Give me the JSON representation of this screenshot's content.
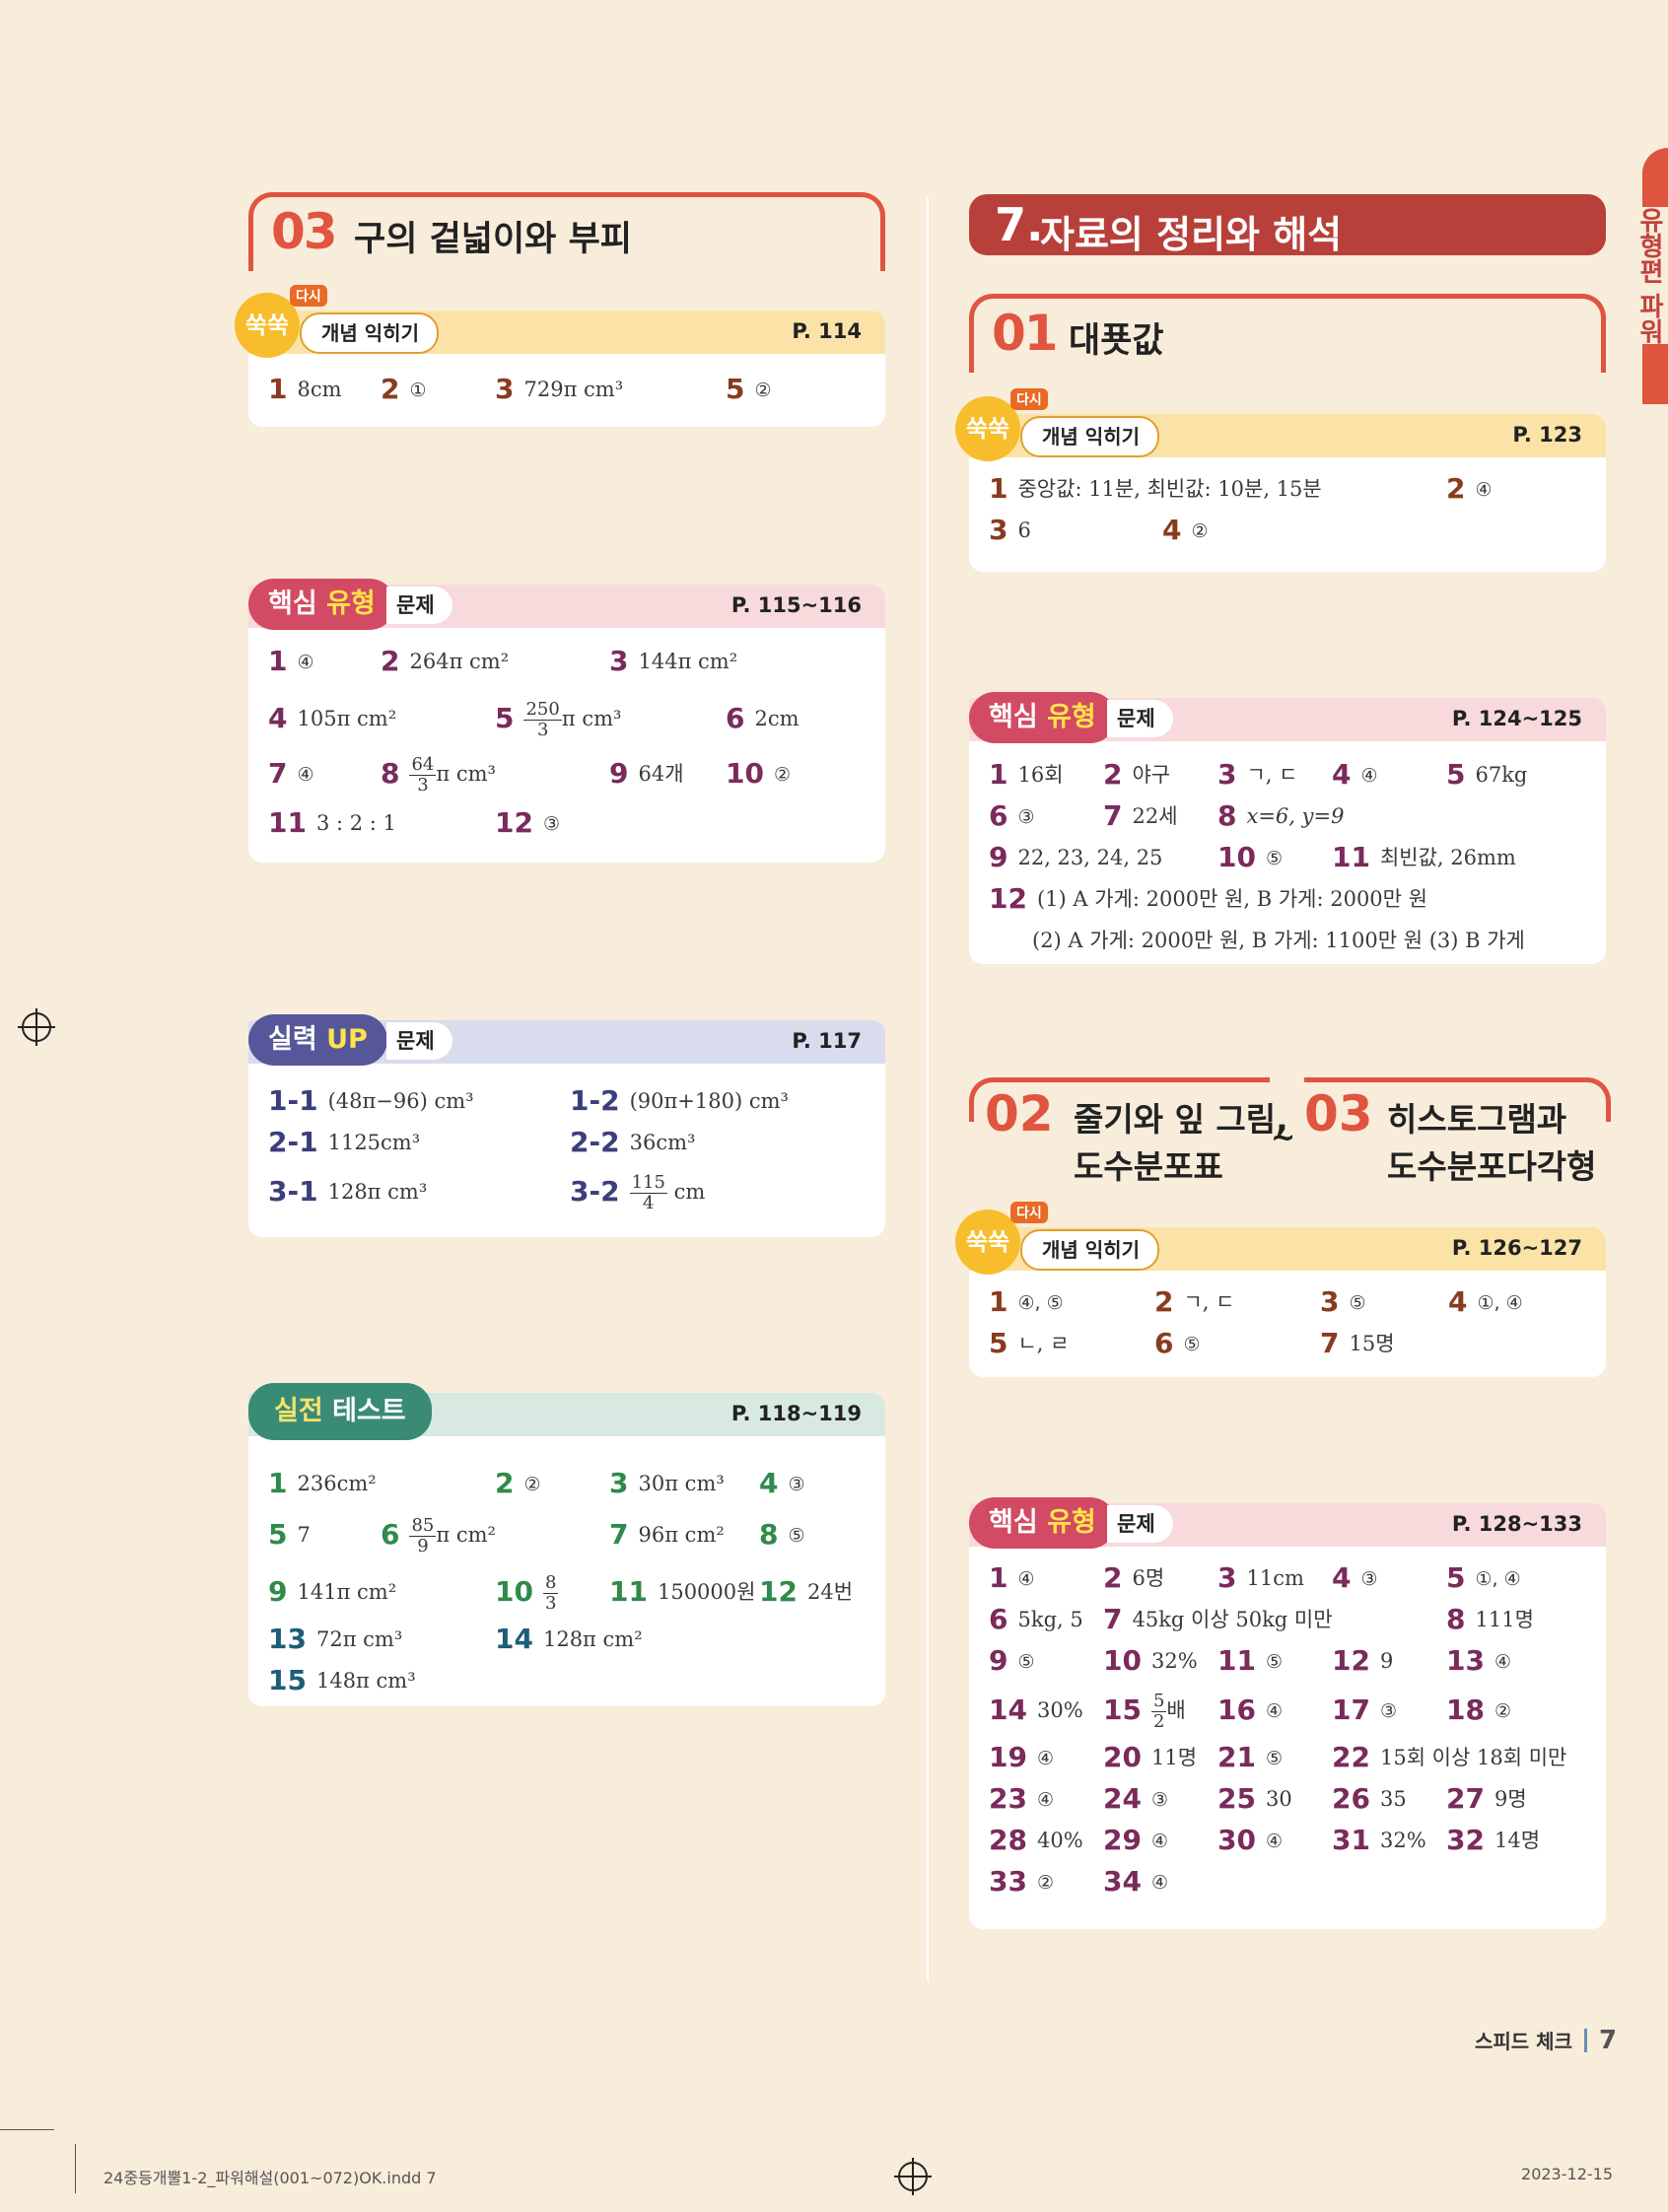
{
  "side_tab": "유형편 파워",
  "left": {
    "section_title": {
      "num": "03",
      "title": "구의 겉넓이와 부피"
    },
    "concept": {
      "badge": "쑥쑥",
      "tag": "다시",
      "label": "개념 익히기",
      "page": "P. 114",
      "answers": [
        {
          "n": "1",
          "v": "8cm"
        },
        {
          "n": "2",
          "v": "①"
        },
        {
          "n": "3",
          "v": "729π cm³"
        },
        {
          "n": "5",
          "v": "②"
        }
      ]
    },
    "core": {
      "label_a": "핵심",
      "label_b": "유형",
      "tail": "문제",
      "page": "P. 115~116",
      "answers": {
        "r1": [
          {
            "n": "1",
            "v": "④"
          },
          {
            "n": "2",
            "v": "264π cm²"
          },
          {
            "n": "3",
            "v": "144π cm²"
          }
        ],
        "r2": [
          {
            "n": "4",
            "v": "105π cm²"
          },
          {
            "n": "5",
            "num": "250",
            "den": "3",
            "v": "π cm³"
          },
          {
            "n": "6",
            "v": "2cm"
          }
        ],
        "r3": [
          {
            "n": "7",
            "v": "④"
          },
          {
            "n": "8",
            "num": "64",
            "den": "3",
            "v": "π cm³"
          },
          {
            "n": "9",
            "v": "64개"
          },
          {
            "n": "10",
            "v": "②"
          }
        ],
        "r4": [
          {
            "n": "11",
            "v": "3 : 2 : 1"
          },
          {
            "n": "12",
            "v": "③"
          }
        ]
      }
    },
    "up": {
      "label_a": "실력",
      "label_b": "UP",
      "tail": "문제",
      "page": "P. 117",
      "answers": [
        {
          "n": "1-1",
          "v": "(48π−96) cm³"
        },
        {
          "n": "1-2",
          "v": "(90π+180) cm³"
        },
        {
          "n": "2-1",
          "v": "1125cm³"
        },
        {
          "n": "2-2",
          "v": "36cm³"
        },
        {
          "n": "3-1",
          "v": "128π cm³"
        },
        {
          "n": "3-2",
          "num": "115",
          "den": "4",
          "v": "cm"
        }
      ]
    },
    "test": {
      "label_a": "실전",
      "label_b": "테스트",
      "page": "P. 118~119",
      "answers": {
        "r1": [
          {
            "n": "1",
            "v": "236cm²"
          },
          {
            "n": "2",
            "v": "②"
          },
          {
            "n": "3",
            "v": "30π cm³"
          },
          {
            "n": "4",
            "v": "③"
          }
        ],
        "r2": [
          {
            "n": "5",
            "v": "7"
          },
          {
            "n": "6",
            "num": "85",
            "den": "9",
            "v": "π cm²"
          },
          {
            "n": "7",
            "v": "96π cm²"
          },
          {
            "n": "8",
            "v": "⑤"
          }
        ],
        "r3": [
          {
            "n": "9",
            "v": "141π cm²"
          },
          {
            "n": "10",
            "num": "8",
            "den": "3"
          },
          {
            "n": "11",
            "v": "150000원"
          },
          {
            "n": "12",
            "v": "24번"
          }
        ],
        "r4": [
          {
            "n": "13",
            "v": "72π cm³"
          },
          {
            "n": "14",
            "v": "128π cm²"
          }
        ],
        "r5": [
          {
            "n": "15",
            "v": "148π cm³"
          }
        ]
      }
    }
  },
  "right": {
    "chapter": {
      "num": "7.",
      "title": "자료의 정리와 해석"
    },
    "sec1": {
      "num": "01",
      "title": "대푯값",
      "concept": {
        "badge": "쑥쑥",
        "tag": "다시",
        "label": "개념 익히기",
        "page": "P. 123",
        "answers": [
          {
            "n": "1",
            "v": "중앙값: 11분, 최빈값: 10분, 15분"
          },
          {
            "n": "2",
            "v": "④"
          },
          {
            "n": "3",
            "v": "6"
          },
          {
            "n": "4",
            "v": "②"
          }
        ]
      },
      "core": {
        "label_a": "핵심",
        "label_b": "유형",
        "tail": "문제",
        "page": "P. 124~125",
        "answers": {
          "r1": [
            {
              "n": "1",
              "v": "16회"
            },
            {
              "n": "2",
              "v": "야구"
            },
            {
              "n": "3",
              "v": "ㄱ, ㄷ"
            },
            {
              "n": "4",
              "v": "④"
            },
            {
              "n": "5",
              "v": "67kg"
            }
          ],
          "r2": [
            {
              "n": "6",
              "v": "③"
            },
            {
              "n": "7",
              "v": "22세"
            },
            {
              "n": "8",
              "v": "x=6, y=9"
            }
          ],
          "r3": [
            {
              "n": "9",
              "v": "22, 23, 24, 25"
            },
            {
              "n": "10",
              "v": "⑤"
            },
            {
              "n": "11",
              "v": "최빈값, 26mm"
            }
          ],
          "r4": [
            {
              "n": "12",
              "v": "(1) A 가게: 2000만 원, B 가게: 2000만 원"
            }
          ],
          "r5": {
            "v": "(2) A 가게: 2000만 원, B 가게: 1100만 원   (3) B 가게"
          }
        }
      }
    },
    "sec2": {
      "num_a": "02",
      "title_a1": "줄기와 잎 그림,",
      "title_a2": "도수분포표",
      "tilde": "~",
      "num_b": "03",
      "title_b1": "히스토그램과",
      "title_b2": "도수분포다각형",
      "concept": {
        "badge": "쑥쑥",
        "tag": "다시",
        "label": "개념 익히기",
        "page": "P. 126~127",
        "answers": {
          "r1": [
            {
              "n": "1",
              "v": "④, ⑤"
            },
            {
              "n": "2",
              "v": "ㄱ, ㄷ"
            },
            {
              "n": "3",
              "v": "⑤"
            },
            {
              "n": "4",
              "v": "①, ④"
            }
          ],
          "r2": [
            {
              "n": "5",
              "v": "ㄴ, ㄹ"
            },
            {
              "n": "6",
              "v": "⑤"
            },
            {
              "n": "7",
              "v": "15명"
            }
          ]
        }
      },
      "core": {
        "label_a": "핵심",
        "label_b": "유형",
        "tail": "문제",
        "page": "P. 128~133",
        "answers": {
          "r1": [
            {
              "n": "1",
              "v": "④"
            },
            {
              "n": "2",
              "v": "6명"
            },
            {
              "n": "3",
              "v": "11cm"
            },
            {
              "n": "4",
              "v": "③"
            },
            {
              "n": "5",
              "v": "①, ④"
            }
          ],
          "r2": [
            {
              "n": "6",
              "v": "5kg, 5"
            },
            {
              "n": "7",
              "v": "45kg 이상 50kg 미만"
            },
            {
              "n": "8",
              "v": "111명"
            }
          ],
          "r3": [
            {
              "n": "9",
              "v": "⑤"
            },
            {
              "n": "10",
              "v": "32%"
            },
            {
              "n": "11",
              "v": "⑤"
            },
            {
              "n": "12",
              "v": "9"
            },
            {
              "n": "13",
              "v": "④"
            }
          ],
          "r4": [
            {
              "n": "14",
              "v": "30%"
            },
            {
              "n": "15",
              "num": "5",
              "den": "2",
              "v": "배"
            },
            {
              "n": "16",
              "v": "④"
            },
            {
              "n": "17",
              "v": "③"
            },
            {
              "n": "18",
              "v": "②"
            }
          ],
          "r5": [
            {
              "n": "19",
              "v": "④"
            },
            {
              "n": "20",
              "v": "11명"
            },
            {
              "n": "21",
              "v": "⑤"
            },
            {
              "n": "22",
              "v": "15회 이상 18회 미만"
            }
          ],
          "r6": [
            {
              "n": "23",
              "v": "④"
            },
            {
              "n": "24",
              "v": "③"
            },
            {
              "n": "25",
              "v": "30"
            },
            {
              "n": "26",
              "v": "35"
            },
            {
              "n": "27",
              "v": "9명"
            }
          ],
          "r7": [
            {
              "n": "28",
              "v": "40%"
            },
            {
              "n": "29",
              "v": "④"
            },
            {
              "n": "30",
              "v": "④"
            },
            {
              "n": "31",
              "v": "32%"
            },
            {
              "n": "32",
              "v": "14명"
            }
          ],
          "r8": [
            {
              "n": "33",
              "v": "②"
            },
            {
              "n": "34",
              "v": "④"
            }
          ]
        }
      }
    }
  },
  "footer": {
    "speed_check": "스피드 체크",
    "page_num": "7",
    "file": "24중등개뿔1-2_파워해설(001~072)OK.indd   7",
    "date": "2023-12-15"
  }
}
